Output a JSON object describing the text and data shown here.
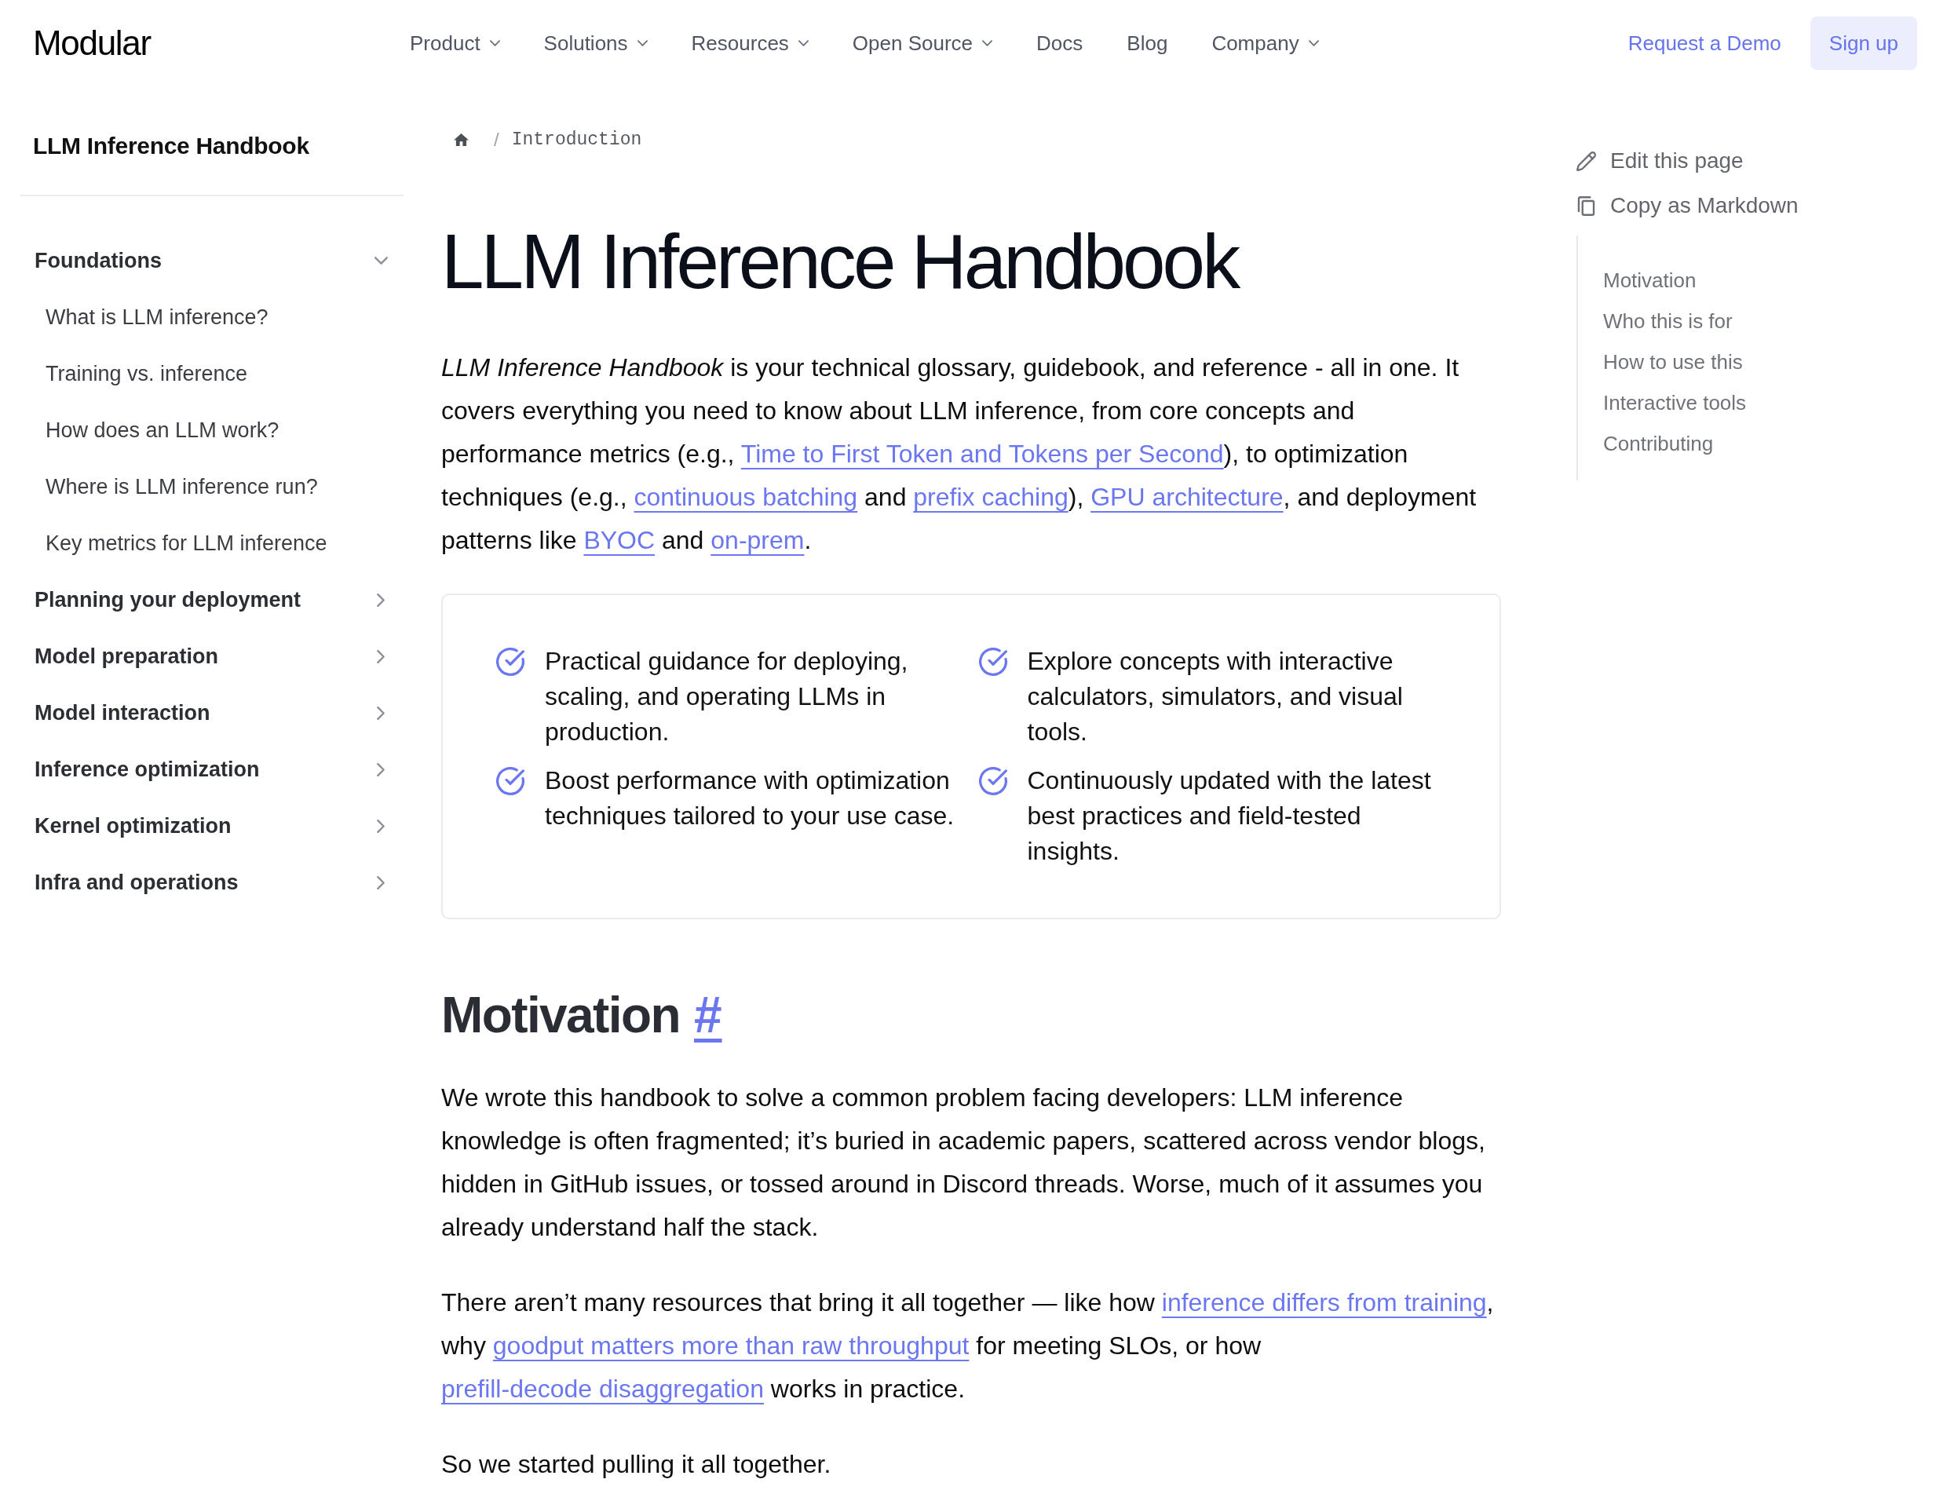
{
  "header": {
    "logo": "Modular",
    "nav": [
      {
        "label": "Product",
        "dropdown": true
      },
      {
        "label": "Solutions",
        "dropdown": true
      },
      {
        "label": "Resources",
        "dropdown": true
      },
      {
        "label": "Open Source",
        "dropdown": true
      },
      {
        "label": "Docs",
        "dropdown": false
      },
      {
        "label": "Blog",
        "dropdown": false
      },
      {
        "label": "Company",
        "dropdown": true
      }
    ],
    "actions": [
      {
        "label": "Request a Demo",
        "kind": "link"
      },
      {
        "label": "Sign up",
        "kind": "button"
      }
    ]
  },
  "sidebar": {
    "title": "LLM Inference Handbook",
    "sections": [
      {
        "label": "Foundations",
        "expanded": true,
        "children": [
          {
            "label": "What is LLM inference?"
          },
          {
            "label": "Training vs. inference"
          },
          {
            "label": "How does an LLM work?"
          },
          {
            "label": "Where is LLM inference run?"
          },
          {
            "label": "Key metrics for LLM inference"
          }
        ]
      },
      {
        "label": "Planning your deployment",
        "expanded": false
      },
      {
        "label": "Model preparation",
        "expanded": false
      },
      {
        "label": "Model interaction",
        "expanded": false
      },
      {
        "label": "Inference optimization",
        "expanded": false
      },
      {
        "label": "Kernel optimization",
        "expanded": false
      },
      {
        "label": "Infra and operations",
        "expanded": false
      }
    ]
  },
  "breadcrumb": {
    "separator": "/",
    "current": "Introduction"
  },
  "title": "LLM Inference Handbook",
  "intro": [
    {
      "kind": "text",
      "text": "*LLM Inference Handbook* is your technical glossary, guidebook, and reference - all in one. It covers everything you need to know about LLM inference, from core concepts and performance metrics (e.g., "
    },
    {
      "kind": "link",
      "text": "Time to First Token and Tokens per Second"
    },
    {
      "kind": "text",
      "text": "), to optimization techniques (e.g., "
    },
    {
      "kind": "link",
      "text": "continuous batching"
    },
    {
      "kind": "text",
      "text": " and "
    },
    {
      "kind": "link",
      "text": "prefix caching"
    },
    {
      "kind": "text",
      "text": "), "
    },
    {
      "kind": "link",
      "text": "GPU architecture"
    },
    {
      "kind": "text",
      "text": ", and deployment patterns like "
    },
    {
      "kind": "link",
      "text": "BYOC"
    },
    {
      "kind": "text",
      "text": " and "
    },
    {
      "kind": "link",
      "text": "on-prem"
    },
    {
      "kind": "text",
      "text": "."
    }
  ],
  "highlights": [
    "Practical guidance for deploying, scaling, and operating LLMs in production.",
    "Explore concepts with interactive calculators, simulators, and visual tools.",
    "Boost performance with optimization techniques tailored to your use case.",
    "Continuously updated with the latest best practices and field-tested insights."
  ],
  "sections": [
    {
      "heading": "Motivation",
      "anchor": "#",
      "paragraphs": [
        [
          {
            "kind": "text",
            "text": "We wrote this handbook to solve a common problem facing developers: LLM inference knowledge is often fragmented; it’s buried in academic papers, scattered across vendor blogs, hidden in GitHub issues, or tossed around in Discord threads. Worse, much of it assumes you already understand half the stack."
          }
        ],
        [
          {
            "kind": "text",
            "text": "There aren’t many resources that bring it all together — like how "
          },
          {
            "kind": "link",
            "text": "inference differs from training"
          },
          {
            "kind": "text",
            "text": ", why "
          },
          {
            "kind": "link",
            "text": "goodput matters more than raw throughput"
          },
          {
            "kind": "text",
            "text": " for meeting SLOs, or how "
          },
          {
            "kind": "link",
            "text": "prefill-decode disaggregation"
          },
          {
            "kind": "text",
            "text": " works in practice."
          }
        ],
        [
          {
            "kind": "text",
            "text": "So we started pulling it all together."
          }
        ]
      ]
    }
  ],
  "page_actions": [
    {
      "label": "Edit this page",
      "kind": "edit"
    },
    {
      "label": "Copy as Markdown",
      "kind": "copy"
    }
  ],
  "toc": [
    {
      "label": "Motivation"
    },
    {
      "label": "Who this is for"
    },
    {
      "label": "How to use this"
    },
    {
      "label": "Interactive tools"
    },
    {
      "label": "Contributing"
    }
  ]
}
